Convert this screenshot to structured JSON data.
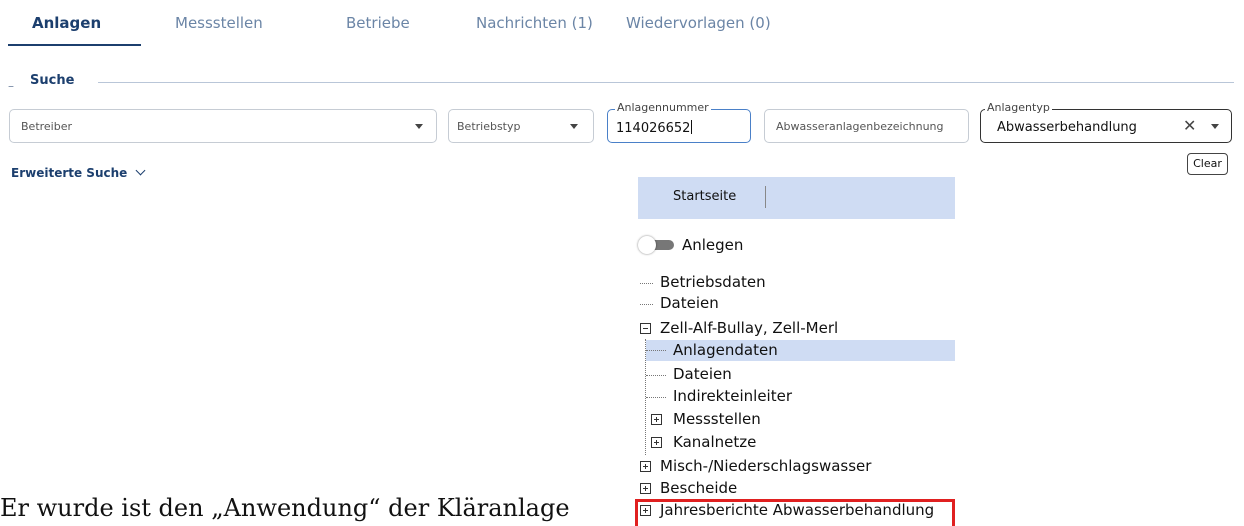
{
  "tabs": [
    {
      "label": "Anlagen",
      "active": true
    },
    {
      "label": "Messstellen"
    },
    {
      "label": "Betriebe"
    },
    {
      "label": "Nachrichten (1)"
    },
    {
      "label": "Wiedervorlagen (0)"
    }
  ],
  "search": {
    "section_label": "Suche",
    "betreiber_placeholder": "Betreiber",
    "betriebstyp_placeholder": "Betriebstyp",
    "anlagennummer_label": "Anlagennummer",
    "anlagennummer_value": "114026652",
    "abwasser_placeholder": "Abwasseranlagenbezeichnung",
    "anlagentyp_label": "Anlagentyp",
    "anlagentyp_value": "Abwasserbehandlung",
    "clear_label": "Clear",
    "advanced_label": "Erweiterte Suche"
  },
  "panel": {
    "title": "Startseite",
    "toggle_label": "Anlegen",
    "tree": [
      {
        "label": "Betriebsdaten"
      },
      {
        "label": "Dateien"
      },
      {
        "label": "Zell-Alf-Bullay, Zell-Merl",
        "expanded": true
      },
      {
        "label": "Anlagendaten",
        "selected": true
      },
      {
        "label": "Dateien"
      },
      {
        "label": "Indirekteinleiter"
      },
      {
        "label": "Messstellen",
        "expandable": true
      },
      {
        "label": "Kanalnetze",
        "expandable": true
      },
      {
        "label": "Misch-/Niederschlagswasser",
        "expandable": true
      },
      {
        "label": "Bescheide",
        "expandable": true
      },
      {
        "label": "Jahresberichte Abwasserbehandlung",
        "expandable": true,
        "highlighted": true
      }
    ]
  },
  "bottom_text": "Er wurde ist den „Anwendung“ der Kläranlage",
  "colors": {
    "accent": "#1c3f6e",
    "selection": "#cfdcf3",
    "highlight": "#e02020"
  }
}
